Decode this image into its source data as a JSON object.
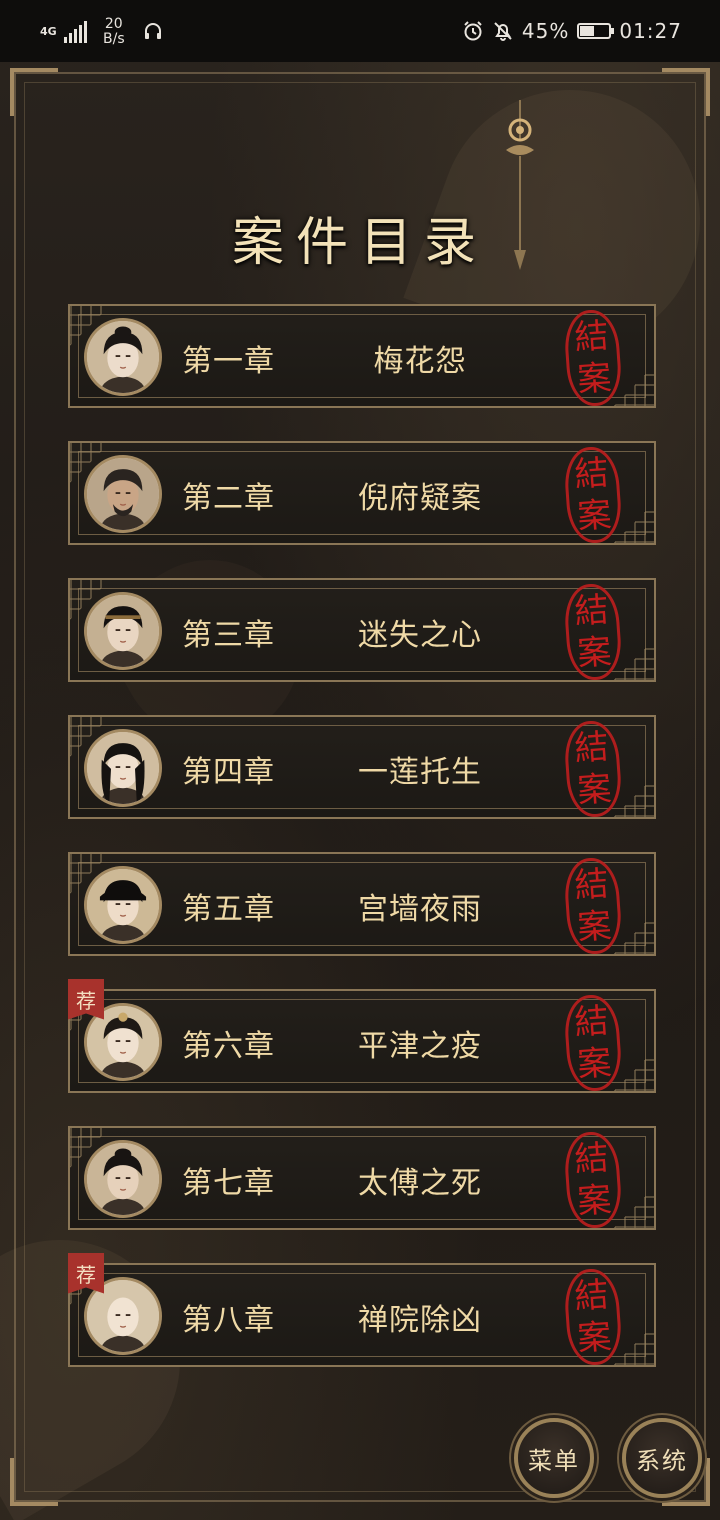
{
  "status_bar": {
    "network": "4G",
    "speed_value": "20",
    "speed_unit": "B/s",
    "battery": "45%",
    "battery_level": 0.45,
    "time": "01:27",
    "icons": [
      "signal-icon",
      "headset-icon",
      "alarm-icon",
      "mute-icon",
      "battery-icon"
    ]
  },
  "page": {
    "title": "案件目录"
  },
  "chapters": [
    {
      "number": "第一章",
      "name": "梅花怨",
      "stamp": "結案",
      "recommended": false,
      "avatar_style": "young-scholar"
    },
    {
      "number": "第二章",
      "name": "倪府疑案",
      "stamp": "結案",
      "recommended": false,
      "avatar_style": "bearded-official"
    },
    {
      "number": "第三章",
      "name": "迷失之心",
      "stamp": "結案",
      "recommended": false,
      "avatar_style": "headband-youth"
    },
    {
      "number": "第四章",
      "name": "一莲托生",
      "stamp": "結案",
      "recommended": false,
      "avatar_style": "long-hair-man"
    },
    {
      "number": "第五章",
      "name": "宫墙夜雨",
      "stamp": "結案",
      "recommended": false,
      "avatar_style": "capped-official"
    },
    {
      "number": "第六章",
      "name": "平津之疫",
      "stamp": "結案",
      "recommended": true,
      "badge": "荐",
      "avatar_style": "ornament-youth"
    },
    {
      "number": "第七章",
      "name": "太傅之死",
      "stamp": "結案",
      "recommended": false,
      "avatar_style": "topknot-man"
    },
    {
      "number": "第八章",
      "name": "禅院除凶",
      "stamp": "結案",
      "recommended": true,
      "badge": "荐",
      "avatar_style": "monk"
    }
  ],
  "buttons": {
    "menu": "菜单",
    "system": "系统"
  },
  "colors": {
    "gold_text": "#efd9a6",
    "frame": "#8a7656",
    "stamp_red": "#cd1e1e",
    "badge_red": "#a8322c"
  }
}
